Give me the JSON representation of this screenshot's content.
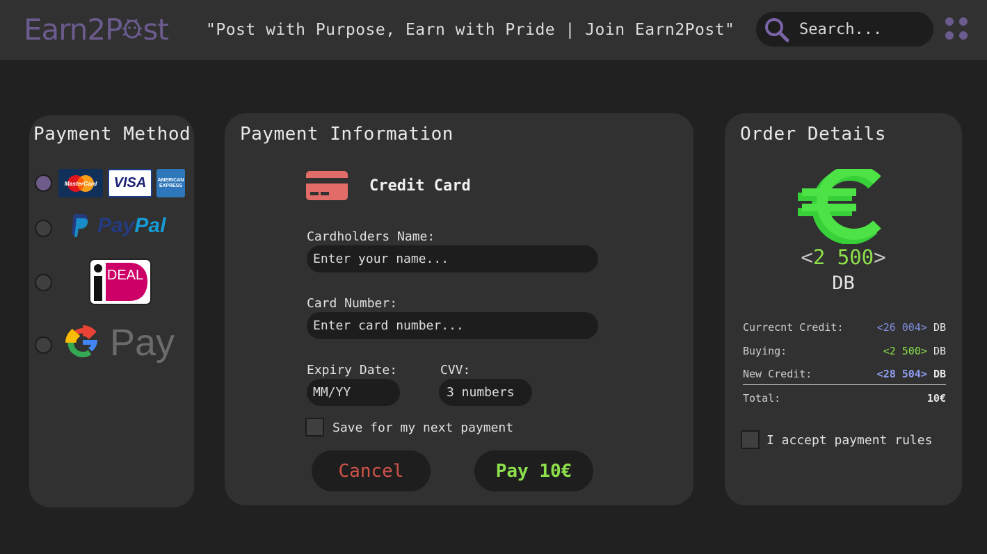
{
  "header": {
    "logo_text": "Earn2Post",
    "logo_prefix": "Earn2P",
    "logo_suffix": "st",
    "tagline": "\"Post with Purpose, Earn with Pride | Join Earn2Post\"",
    "search_placeholder": "Search..."
  },
  "payment_method": {
    "title": "Payment Method",
    "options": [
      {
        "name": "cards",
        "labels": [
          "MasterCard",
          "VISA",
          "AMERICAN EXPRESS"
        ],
        "selected": true
      },
      {
        "name": "paypal",
        "label_pay": "Pay",
        "label_pal": "Pal",
        "selected": false
      },
      {
        "name": "ideal",
        "label": "DEAL",
        "selected": false
      },
      {
        "name": "gpay",
        "label": "Pay",
        "selected": false
      }
    ]
  },
  "payment_info": {
    "title": "Payment Information",
    "method_label": "Credit Card",
    "name_label": "Cardholders Name:",
    "name_placeholder": "Enter your name...",
    "number_label": "Card Number:",
    "number_placeholder": "Enter card number...",
    "expiry_label": "Expiry Date:",
    "expiry_placeholder": "MM/YY",
    "cvv_label": "CVV:",
    "cvv_placeholder": "3 numbers",
    "save_label": "Save for my next payment",
    "cancel_label": "Cancel",
    "pay_label": "Pay 10€"
  },
  "order_details": {
    "title": "Order Details",
    "amount": "2 500",
    "currency": "DB",
    "rows": [
      {
        "label": "Currecnt Credit:",
        "value": "26 004",
        "unit": "DB"
      },
      {
        "label": "Buying:",
        "value": "2 500",
        "unit": "DB"
      },
      {
        "label": "New Credit:",
        "value": "28 504",
        "unit": "DB"
      },
      {
        "label": "Total:",
        "value": "10€"
      }
    ],
    "accept_label": "I accept payment rules"
  },
  "colors": {
    "background": "#212121",
    "panel": "#313131",
    "accent_purple": "#6c5b8e",
    "green": "#4de346",
    "blue": "#7f8fe0",
    "cancel_red": "#d2524a",
    "card_icon": "#e26d68"
  }
}
